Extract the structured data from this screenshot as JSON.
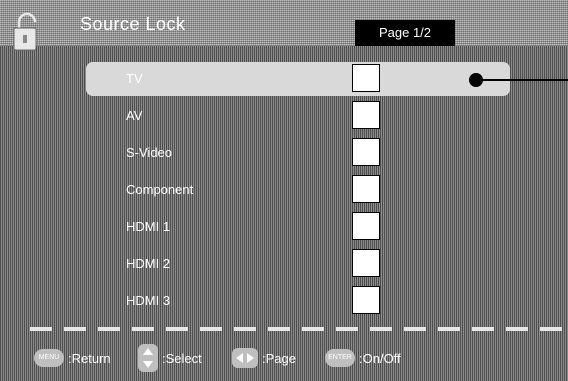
{
  "header": {
    "title": "Source Lock",
    "page_indicator": "Page 1/2"
  },
  "source_list": [
    {
      "label": "TV",
      "checked": false,
      "selected": true
    },
    {
      "label": "AV",
      "checked": false,
      "selected": false
    },
    {
      "label": "S-Video",
      "checked": false,
      "selected": false
    },
    {
      "label": "Component",
      "checked": false,
      "selected": false
    },
    {
      "label": "HDMI 1",
      "checked": false,
      "selected": false
    },
    {
      "label": "HDMI 2",
      "checked": false,
      "selected": false
    },
    {
      "label": "HDMI 3",
      "checked": false,
      "selected": false
    }
  ],
  "footer": {
    "menu_key": "MENU",
    "return_label": ":Return",
    "select_label": ":Select",
    "page_label": ":Page",
    "enter_key": "ENTER",
    "onoff_label": ":On/Off"
  },
  "icons": {
    "header": "lock-icon",
    "select": "up-down-arrows-icon",
    "page": "left-right-arrows-icon"
  }
}
